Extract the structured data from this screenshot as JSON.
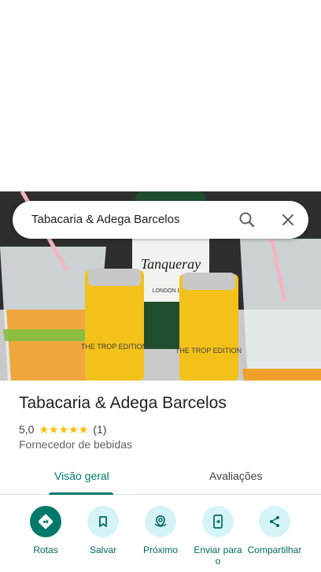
{
  "search": {
    "query": "Tabacaria & Adega Barcelos"
  },
  "hero": {
    "bottle_label": "Tanqueray",
    "bottle_sub": "LONDON DRY",
    "can_label": "THE TROP EDITION"
  },
  "place": {
    "name": "Tabacaria & Adega Barcelos",
    "rating": "5,0",
    "stars": 5,
    "review_count": "(1)",
    "category": "Fornecedor de bebidas"
  },
  "tabs": [
    {
      "label": "Visão geral",
      "active": true
    },
    {
      "label": "Avaliações",
      "active": false
    }
  ],
  "actions": [
    {
      "label": "Rotas",
      "icon": "directions-icon",
      "primary": true
    },
    {
      "label": "Salvar",
      "icon": "bookmark-icon",
      "primary": false
    },
    {
      "label": "Próximo",
      "icon": "nearby-icon",
      "primary": false
    },
    {
      "label": "Enviar para o",
      "icon": "send-to-phone-icon",
      "primary": false
    },
    {
      "label": "Compartilhar",
      "icon": "share-icon",
      "primary": false
    }
  ],
  "colors": {
    "accent": "#00796b",
    "star": "#fbbc04",
    "action_bg": "#d5f4f8"
  }
}
